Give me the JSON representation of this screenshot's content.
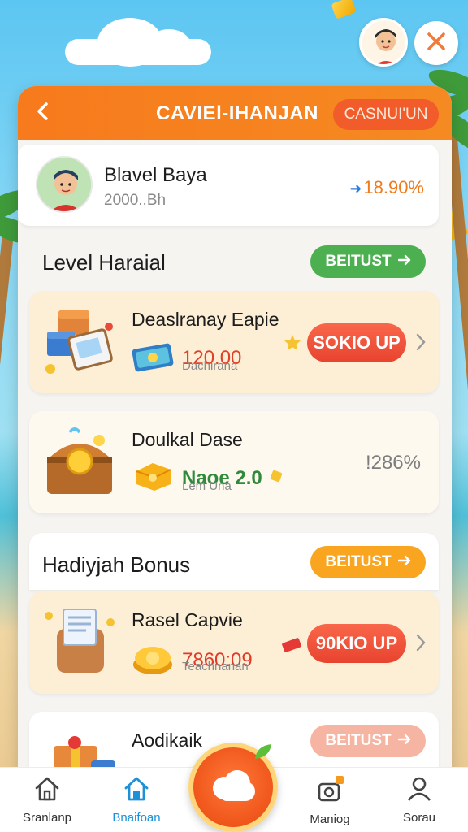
{
  "header": {
    "title": "CAVIEl-IHANJAN",
    "pill_label": "CASNUI'UN"
  },
  "profile": {
    "name": "Blavel Baya",
    "subtitle": "2000..Bh",
    "stat": "18.90%"
  },
  "sections": [
    {
      "title": "Level Haraial",
      "button_label": "BEITUST"
    },
    {
      "title": "Hadiyjah Bonus",
      "button_label": "BEITUST"
    }
  ],
  "items": [
    {
      "title": "Deaslranay Eapie",
      "value": "120.00",
      "sub": "Dachirana",
      "claim_label": "SOKIO UP"
    },
    {
      "title": "Doulkal Dase",
      "value": "Naoe 2.0",
      "sub": "Lem Una",
      "percent": "!286%"
    },
    {
      "title": "Rasel Capvie",
      "value": "7860:09",
      "sub": "Teachnanan",
      "claim_label": "90KIO UP"
    },
    {
      "title": "Aodikaik",
      "button_label": "BEITUST"
    }
  ],
  "bottom_nav": [
    {
      "label": "Sranlanp",
      "icon": "home-icon"
    },
    {
      "label": "Bnaifoan",
      "icon": "home-icon",
      "active": true
    },
    {
      "label": "Maniog",
      "icon": "gift-icon"
    },
    {
      "label": "Sorau",
      "icon": "profile-icon"
    }
  ],
  "colors": {
    "accent_orange": "#f77a1c",
    "claim_red": "#e8432f",
    "green": "#4caf50",
    "nav_active": "#1e90d6"
  }
}
